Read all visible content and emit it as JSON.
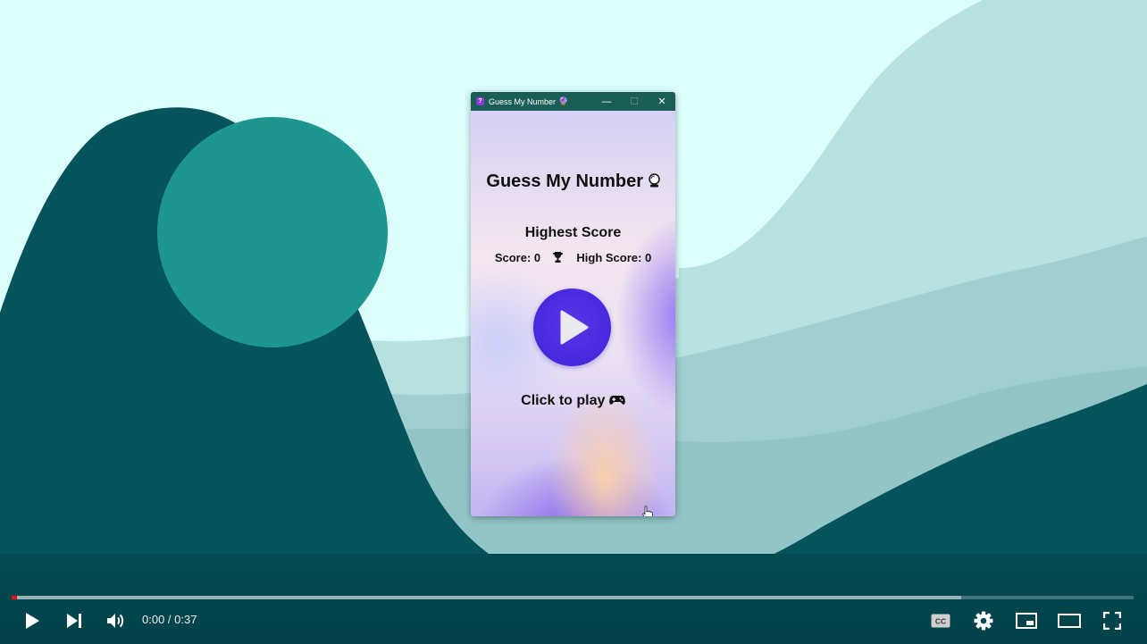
{
  "window": {
    "title": "Guess My Number",
    "title_emoji": "🔮",
    "minimize_label": "—",
    "maximize_label": "☐",
    "close_label": "✕",
    "app_icon": "question-mark-icon"
  },
  "game": {
    "title": "Guess My Number",
    "title_icon": "crystal-ball-icon",
    "highest_score_heading": "Highest Score",
    "score_text": "Score: 0",
    "high_score_text": "High Score: 0",
    "score_separator_icon": "trophy-icon",
    "play_button_icon": "play-icon",
    "cta_text": "Click to play",
    "cta_icon": "game-controller-icon"
  },
  "player": {
    "time_display": "0:00 / 0:37",
    "played_fraction": 0.0,
    "buffered_fraction": 0.846,
    "controls": [
      "play-icon",
      "next-icon",
      "volume-icon",
      "captions-icon",
      "settings-icon",
      "miniplayer-icon",
      "theater-mode-icon",
      "fullscreen-icon"
    ]
  },
  "colors": {
    "titlebar": "#1b5e56",
    "play_button": "#4a2ae0",
    "progress_played": "#ff0000",
    "background_dark": "#06535a",
    "background_circle": "#1e9690"
  }
}
